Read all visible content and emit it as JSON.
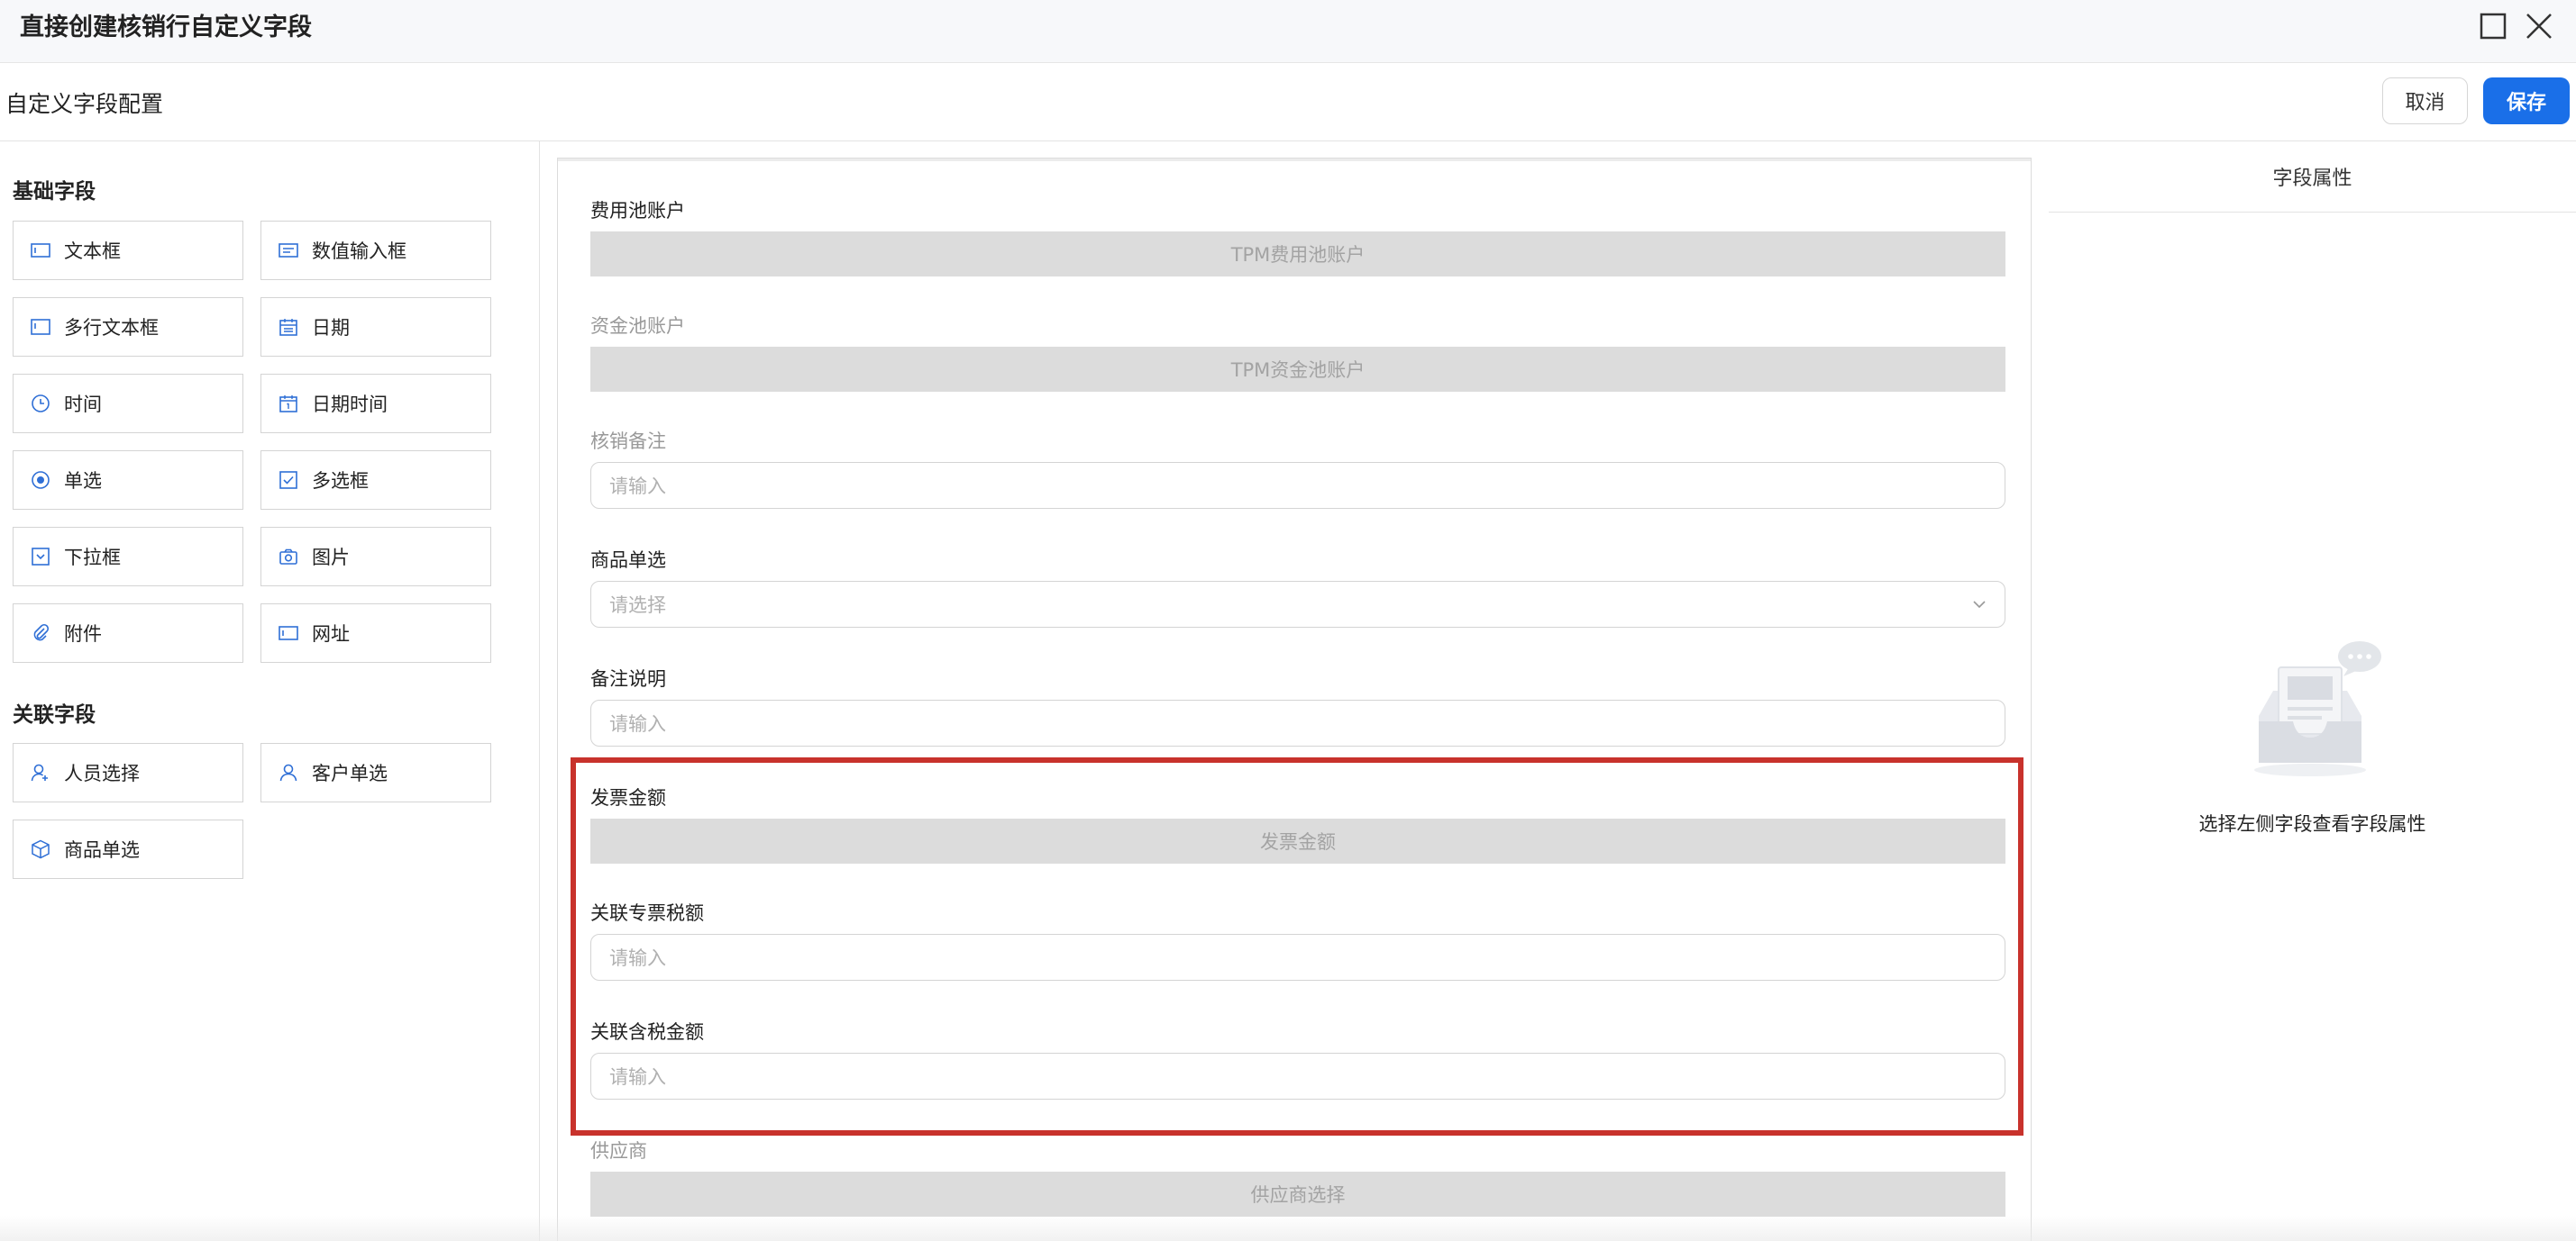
{
  "window": {
    "title": "直接创建核销行自定义字段"
  },
  "header": {
    "title": "自定义字段配置",
    "cancel_label": "取消",
    "save_label": "保存"
  },
  "left_panel": {
    "basic_title": "基础字段",
    "basic_fields": [
      {
        "label": "文本框",
        "icon": "text-box-icon"
      },
      {
        "label": "数值输入框",
        "icon": "number-input-icon"
      },
      {
        "label": "多行文本框",
        "icon": "textarea-icon"
      },
      {
        "label": "日期",
        "icon": "calendar-icon"
      },
      {
        "label": "时间",
        "icon": "clock-icon"
      },
      {
        "label": "日期时间",
        "icon": "calendar-date-icon"
      },
      {
        "label": "单选",
        "icon": "radio-icon"
      },
      {
        "label": "多选框",
        "icon": "checkbox-icon"
      },
      {
        "label": "下拉框",
        "icon": "dropdown-icon"
      },
      {
        "label": "图片",
        "icon": "camera-icon"
      },
      {
        "label": "附件",
        "icon": "paperclip-icon"
      },
      {
        "label": "网址",
        "icon": "url-icon"
      }
    ],
    "related_title": "关联字段",
    "related_fields": [
      {
        "label": "人员选择",
        "icon": "person-add-icon"
      },
      {
        "label": "客户单选",
        "icon": "person-icon"
      },
      {
        "label": "商品单选",
        "icon": "box-icon"
      }
    ]
  },
  "canvas": {
    "fields": [
      {
        "label": "费用池账户",
        "type": "readonly",
        "value": "TPM费用池账户"
      },
      {
        "label": "资金池账户",
        "type": "readonly",
        "value": "TPM资金池账户"
      },
      {
        "label": "核销备注",
        "type": "input",
        "placeholder": "请输入"
      },
      {
        "label": "商品单选",
        "type": "select",
        "placeholder": "请选择"
      },
      {
        "label": "备注说明",
        "type": "input",
        "placeholder": "请输入"
      },
      {
        "label": "发票金额",
        "type": "readonly",
        "value": "发票金额"
      },
      {
        "label": "关联专票税额",
        "type": "input",
        "placeholder": "请输入"
      },
      {
        "label": "关联含税金额",
        "type": "input",
        "placeholder": "请输入"
      },
      {
        "label": "供应商",
        "type": "readonly",
        "value": "供应商选择"
      }
    ]
  },
  "right_panel": {
    "title": "字段属性",
    "empty_text": "选择左侧字段查看字段属性"
  },
  "colors": {
    "accent": "#1a6fe8",
    "highlight": "#c8322c",
    "icon": "#2f6fd6"
  }
}
